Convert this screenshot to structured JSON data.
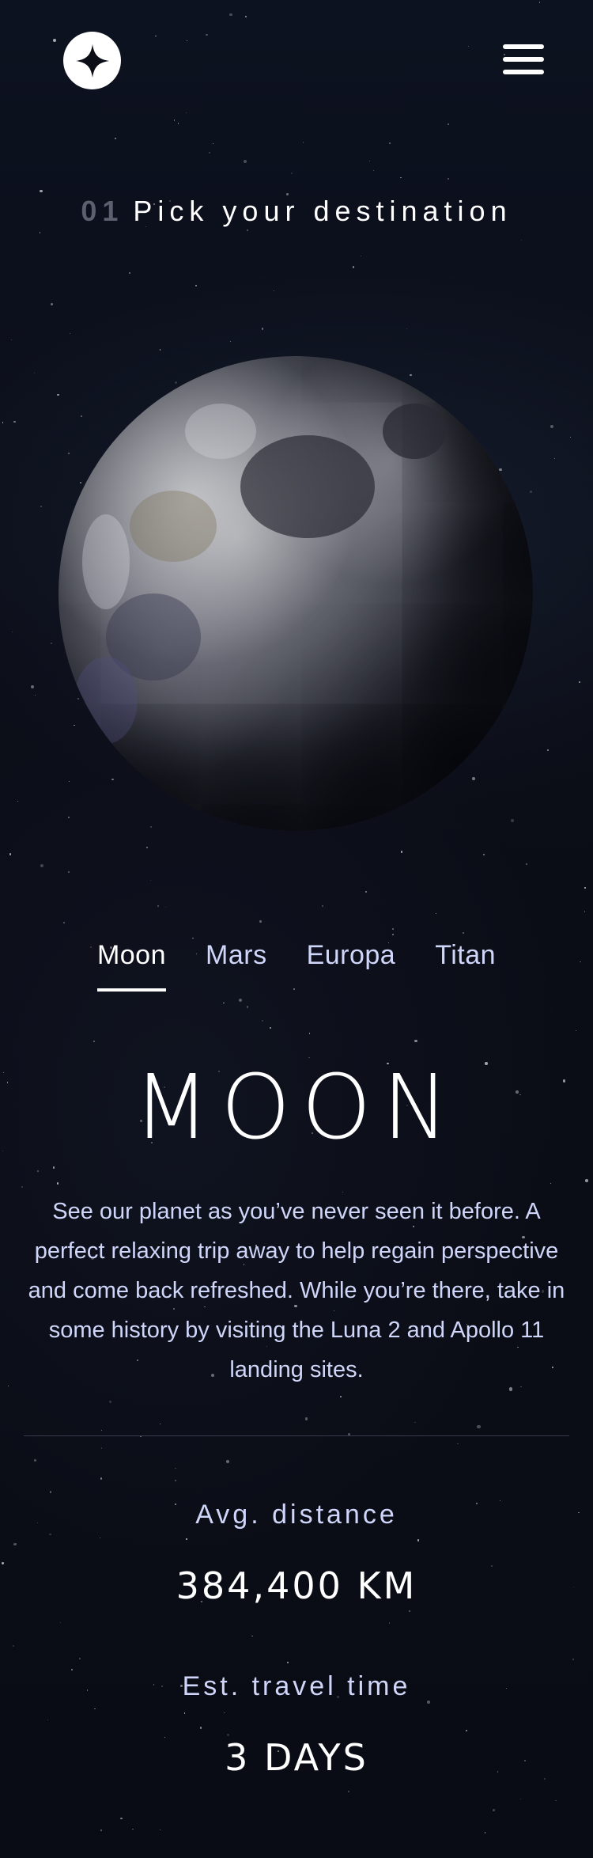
{
  "header": {
    "logo_icon": "star-logo-icon",
    "menu_icon": "hamburger-menu-icon"
  },
  "section": {
    "number": "01",
    "title": "Pick your destination"
  },
  "planet_image": "moon",
  "tabs": [
    {
      "label": "Moon",
      "active": true
    },
    {
      "label": "Mars",
      "active": false
    },
    {
      "label": "Europa",
      "active": false
    },
    {
      "label": "Titan",
      "active": false
    }
  ],
  "destination": {
    "name": "MOON",
    "description": "See our planet as you’ve never seen it before. A perfect relaxing trip away to help regain perspective and come back refreshed. While you’re there, take in some history by visiting the Luna 2 and Apollo 11 landing sites."
  },
  "stats": {
    "distance_label": "Avg. distance",
    "distance_value": "384,400 KM",
    "travel_label": "Est. travel time",
    "travel_value": "3 DAYS"
  },
  "colors": {
    "background": "#0b0d17",
    "accent": "#d0d6f9",
    "text": "#ffffff",
    "muted_number": "#5b5f6e"
  }
}
